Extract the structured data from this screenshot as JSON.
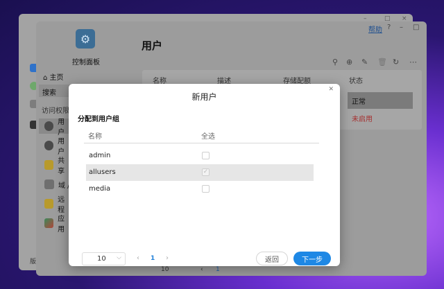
{
  "background_window": {
    "sidebar_bottom_text": "版"
  },
  "window": {
    "help_label": "帮助",
    "controls": [
      "?",
      "–",
      "□",
      "×"
    ]
  },
  "app": {
    "name": "控制面板",
    "page_title": "用户"
  },
  "sidebar": {
    "home": "主页",
    "search_placeholder": "搜索",
    "section": "访问权限",
    "items": [
      {
        "label": "用户",
        "icon": "user-icon"
      },
      {
        "label": "用户",
        "icon": "user-group-icon"
      },
      {
        "label": "共享",
        "icon": "shared-folder-icon"
      },
      {
        "label": "域 /",
        "icon": "domain-icon"
      },
      {
        "label": "远程",
        "icon": "remote-folder-icon"
      },
      {
        "label": "应用",
        "icon": "app-icon"
      }
    ]
  },
  "toolbar": {
    "icons": [
      "search-icon",
      "add-icon",
      "edit-icon",
      "delete-icon",
      "refresh-icon",
      "more-icon"
    ]
  },
  "user_table": {
    "columns": [
      "名称",
      "描述",
      "存储配额",
      "状态"
    ],
    "statuses": [
      "正常",
      "未启用"
    ],
    "page_size": "10",
    "page": "1"
  },
  "dialog": {
    "title": "新用户",
    "subtitle": "分配到用户组",
    "col_name": "名称",
    "col_select_all": "全选",
    "groups": [
      {
        "name": "admin",
        "checked": false
      },
      {
        "name": "allusers",
        "checked": true
      },
      {
        "name": "media",
        "checked": false
      }
    ],
    "page_size": "10",
    "page": "1",
    "back_label": "返回",
    "next_label": "下一步"
  },
  "colors": {
    "accent": "#1e88e5",
    "disabled_status": "#a53030"
  }
}
